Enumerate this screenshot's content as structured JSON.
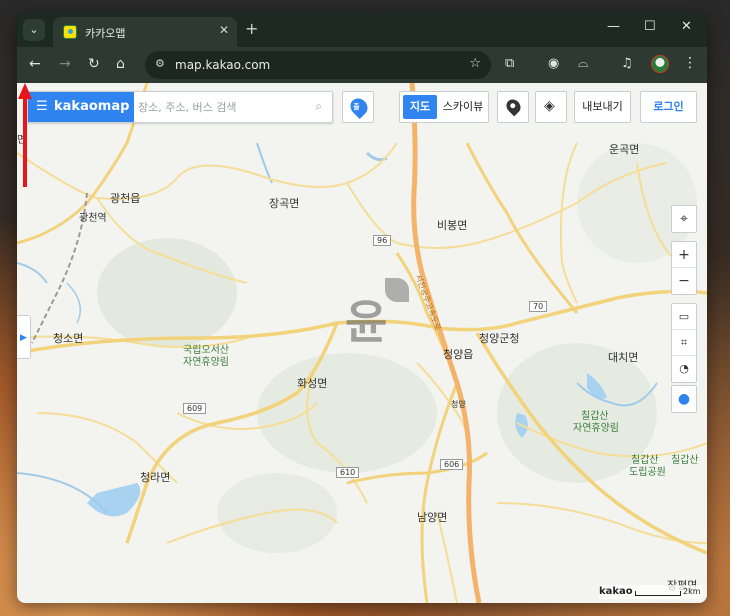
{
  "browser": {
    "tab_title": "카카오맵",
    "url": "map.kakao.com",
    "new_tab": "+",
    "close_tab": "✕",
    "window_controls": {
      "minimize": "—",
      "maximize": "☐",
      "close": "✕"
    }
  },
  "map_ui": {
    "logo": "kakaomap",
    "search_placeholder": "장소, 주소, 버스 검색",
    "route_label": "출",
    "maptype_active": "지도",
    "maptype_sky": "스카이뷰",
    "export_button": "내보내기",
    "login_button": "로그인",
    "scale_brand": "kakao",
    "scale_text": "2km",
    "watermark": "윤"
  },
  "map_labels": {
    "gwangcheon_eup": "광천읍",
    "gwangcheon_station": "광천역",
    "janggok": "장곡면",
    "bibong": "비봉면",
    "ungok": "운곡면",
    "cheongso": "청소면",
    "natural_forest": "국립오서산",
    "natural_forest_2": "자연휴양림",
    "hwaseong": "화성면",
    "cheongyang_eup": "청양읍",
    "cheongyang_county": "청양군청",
    "cheongyang_ic": "청양",
    "daechi": "대치면",
    "chilgapsan_1": "칠갑산",
    "chilgapsan_2": "자연휴양림",
    "chilgapsan_park_1": "칠갑산",
    "chilgapsan_park_2": "도립공원",
    "chilgapsan_r": "칠갑산",
    "cheongna": "청라면",
    "namyang": "남양면",
    "jangpyeong": "장평면",
    "route_96": "96",
    "route_70": "70",
    "route_609": "609",
    "route_610": "610",
    "route_606": "606",
    "left_edge": "면",
    "expressway": "서천공주고속도로"
  },
  "colors": {
    "kakao_blue": "#2f84f0",
    "arrow_red": "#e8161a",
    "road_yellow": "#f2d27a",
    "expressway_orange": "#f3b36a"
  }
}
